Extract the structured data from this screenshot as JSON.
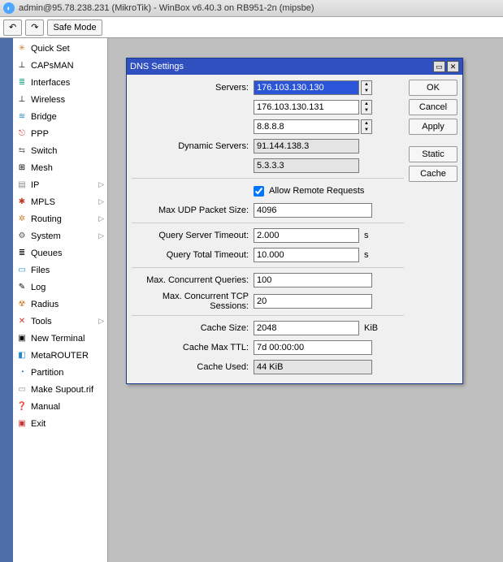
{
  "app": {
    "title": "admin@95.78.238.231 (MikroTik) - WinBox v6.40.3 on RB951-2n (mipsbe)",
    "icon_glyph": "◐"
  },
  "toolbar": {
    "undo_glyph": "↶",
    "redo_glyph": "↷",
    "safe_mode": "Safe Mode"
  },
  "sidebar": {
    "items": [
      {
        "label": "Quick Set",
        "icon": "✳",
        "color": "#d08030"
      },
      {
        "label": "CAPsMAN",
        "icon": "⊥",
        "color": "#000"
      },
      {
        "label": "Interfaces",
        "icon": "≣",
        "color": "#2a8"
      },
      {
        "label": "Wireless",
        "icon": "⊥",
        "color": "#000"
      },
      {
        "label": "Bridge",
        "icon": "≋",
        "color": "#28c"
      },
      {
        "label": "PPP",
        "icon": "⎋",
        "color": "#d33"
      },
      {
        "label": "Switch",
        "icon": "⇆",
        "color": "#777"
      },
      {
        "label": "Mesh",
        "icon": "⊞",
        "color": "#000"
      },
      {
        "label": "IP",
        "icon": "▤",
        "color": "#888",
        "sub": true
      },
      {
        "label": "MPLS",
        "icon": "✱",
        "color": "#c0392b",
        "sub": true
      },
      {
        "label": "Routing",
        "icon": "✲",
        "color": "#d08030",
        "sub": true
      },
      {
        "label": "System",
        "icon": "⚙",
        "color": "#555",
        "sub": true
      },
      {
        "label": "Queues",
        "icon": "≣",
        "color": "#000"
      },
      {
        "label": "Files",
        "icon": "▭",
        "color": "#28c"
      },
      {
        "label": "Log",
        "icon": "✎",
        "color": "#000"
      },
      {
        "label": "Radius",
        "icon": "☢",
        "color": "#d08030"
      },
      {
        "label": "Tools",
        "icon": "✕",
        "color": "#c33",
        "sub": true
      },
      {
        "label": "New Terminal",
        "icon": "▣",
        "color": "#000"
      },
      {
        "label": "MetaROUTER",
        "icon": "◧",
        "color": "#28c"
      },
      {
        "label": "Partition",
        "icon": "◔",
        "color": "#28c"
      },
      {
        "label": "Make Supout.rif",
        "icon": "▭",
        "color": "#888"
      },
      {
        "label": "Manual",
        "icon": "❓",
        "color": "#28c"
      },
      {
        "label": "Exit",
        "icon": "▣",
        "color": "#c33"
      }
    ]
  },
  "dialog": {
    "title": "DNS Settings",
    "buttons": {
      "ok": "OK",
      "cancel": "Cancel",
      "apply": "Apply",
      "static": "Static",
      "cache": "Cache"
    },
    "labels": {
      "servers": "Servers:",
      "dyn_servers": "Dynamic Servers:",
      "allow_remote": "Allow Remote Requests",
      "max_udp": "Max UDP Packet Size:",
      "q_server_to": "Query Server Timeout:",
      "q_total_to": "Query Total Timeout:",
      "max_conc_q": "Max. Concurrent Queries:",
      "max_conc_tcp": "Max. Concurrent TCP Sessions:",
      "cache_size": "Cache Size:",
      "cache_max_ttl": "Cache Max TTL:",
      "cache_used": "Cache Used:"
    },
    "values": {
      "server1": "176.103.130.130",
      "server2": "176.103.130.131",
      "server3": "8.8.8.8",
      "dyn1": "91.144.138.3",
      "dyn2": "5.3.3.3",
      "allow_remote": true,
      "max_udp": "4096",
      "q_server_to": "2.000",
      "q_total_to": "10.000",
      "max_conc_q": "100",
      "max_conc_tcp": "20",
      "cache_size": "2048",
      "cache_max_ttl": "7d 00:00:00",
      "cache_used": "44 KiB"
    },
    "units": {
      "seconds": "s",
      "kib": "KiB"
    }
  }
}
